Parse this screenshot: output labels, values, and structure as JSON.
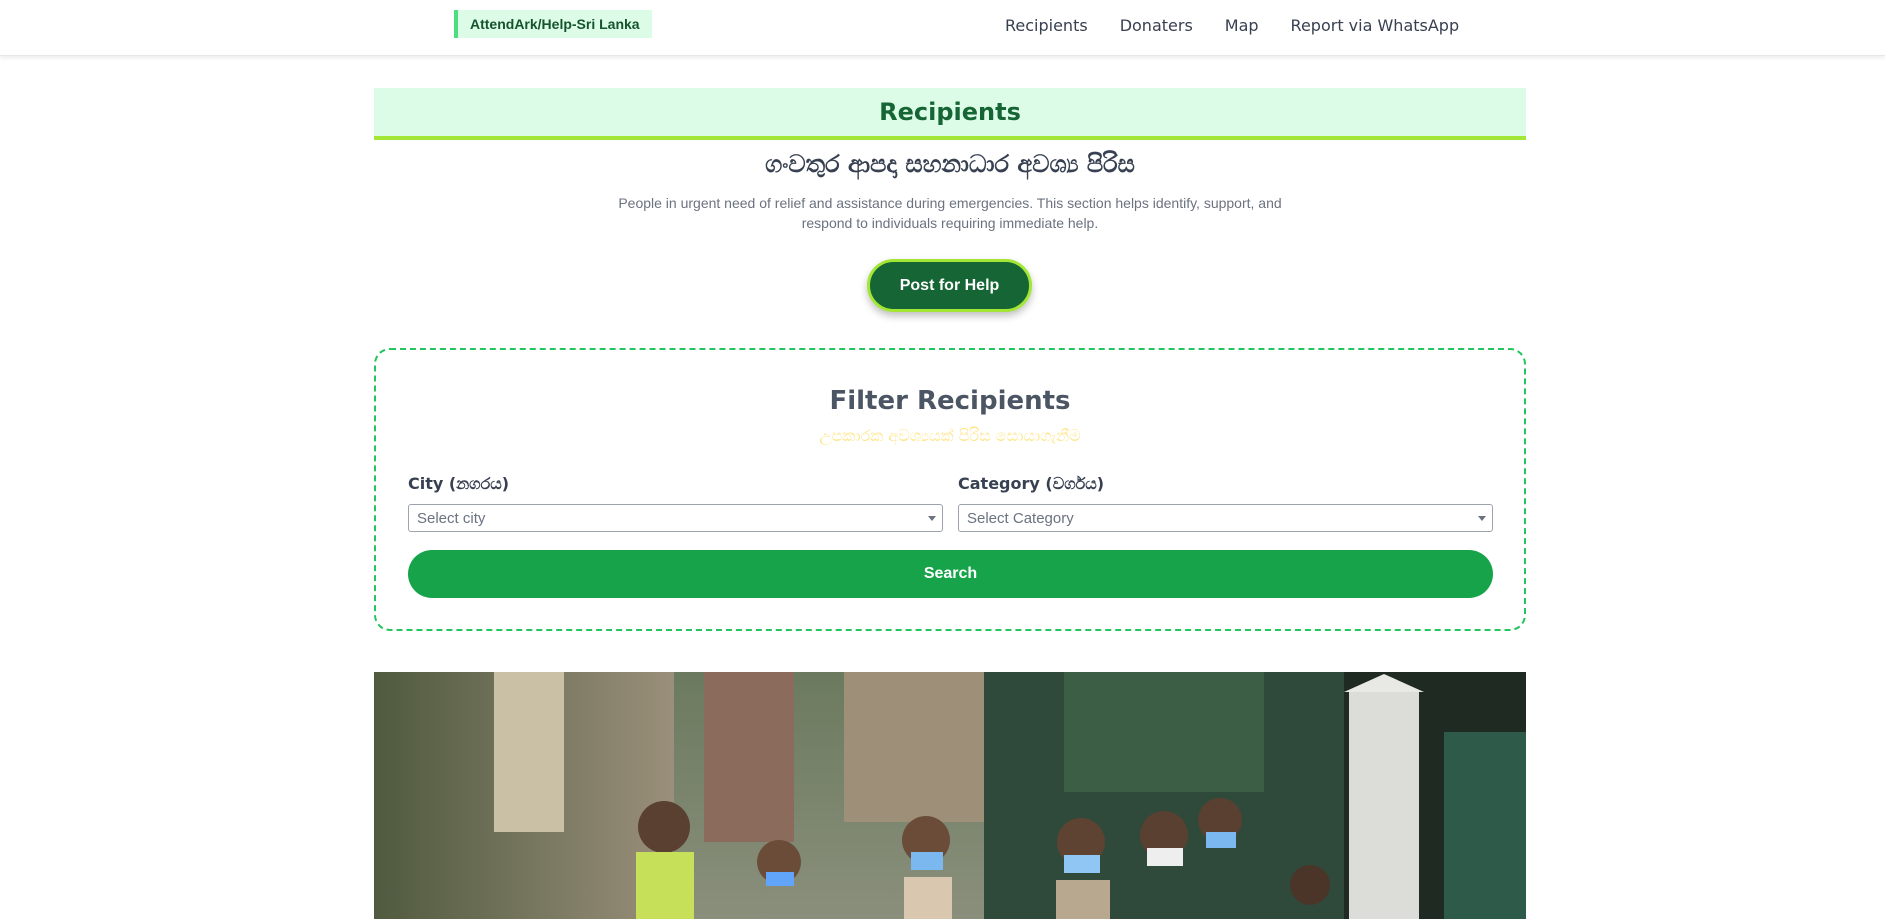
{
  "header": {
    "brand": "AttendArk/Help-Sri Lanka",
    "nav": [
      "Recipients",
      "Donaters",
      "Map",
      "Report via WhatsApp"
    ]
  },
  "main": {
    "title": "Recipients",
    "sinhala_title": "ගංවතුර ආපදා සහනාධාර අවශ්‍ය පිරිස",
    "description": "People in urgent need of relief and assistance during emergencies. This section helps identify, support, and respond to individuals requiring immediate help.",
    "post_button": "Post for Help"
  },
  "filter": {
    "title": "Filter Recipients",
    "subtitle": "උපකාරක අවශ්‍යයක් පිරිස සොයාගැනීම",
    "city_label": "City (නගරය)",
    "city_placeholder": "Select city",
    "category_label": "Category (වර්ගය)",
    "category_placeholder": "Select Category",
    "search_button": "Search"
  },
  "colors": {
    "accent_dark": "#166534",
    "accent": "#16a34a",
    "band_bg": "#dcfce7",
    "lime": "#a3e635"
  }
}
